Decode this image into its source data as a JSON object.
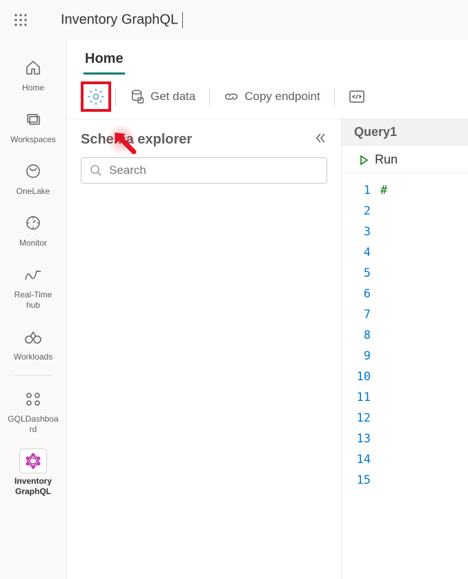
{
  "header": {
    "app_title": "Inventory GraphQL"
  },
  "left_rail": {
    "items": [
      {
        "label": "Home",
        "icon": "home-icon"
      },
      {
        "label": "Workspaces",
        "icon": "workspaces-icon"
      },
      {
        "label": "OneLake",
        "icon": "onelake-icon"
      },
      {
        "label": "Monitor",
        "icon": "monitor-icon"
      },
      {
        "label": "Real-Time hub",
        "icon": "realtime-icon"
      },
      {
        "label": "Workloads",
        "icon": "workloads-icon"
      },
      {
        "label": "GQLDashboard",
        "icon": "dashboard-icon"
      },
      {
        "label": "Inventory GraphQL",
        "icon": "graphql-icon",
        "active": true
      }
    ]
  },
  "tabs": {
    "home_label": "Home"
  },
  "toolbar": {
    "get_data_label": "Get data",
    "copy_endpoint_label": "Copy endpoint"
  },
  "schema_explorer": {
    "title": "Schema explorer",
    "search_placeholder": "Search"
  },
  "query_panel": {
    "tab_label": "Query1",
    "run_label": "Run"
  },
  "editor": {
    "line_numbers": [
      "1",
      "2",
      "3",
      "4",
      "5",
      "6",
      "7",
      "8",
      "9",
      "10",
      "11",
      "12",
      "13",
      "14",
      "15"
    ],
    "first_line_prefix": "#"
  }
}
